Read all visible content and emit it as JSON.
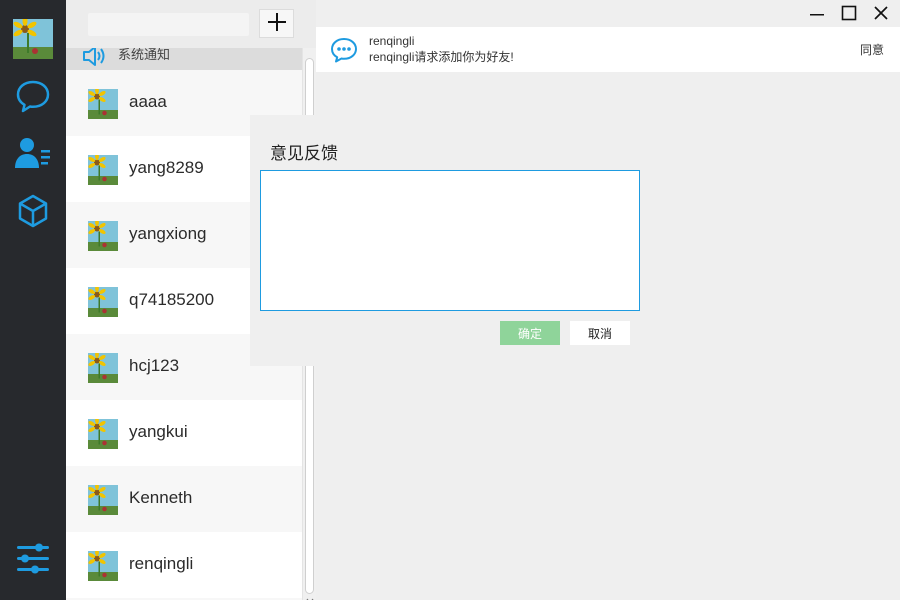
{
  "colors": {
    "rail_bg": "#27292d",
    "accent": "#1e9be0",
    "confirm_green": "#8fd49a"
  },
  "sidebar": {
    "nav_icons": [
      "chat-bubble-icon",
      "contacts-icon",
      "cube-icon"
    ],
    "settings_icon": "sliders-icon"
  },
  "search": {
    "value": "",
    "placeholder": "",
    "add_icon": "plus-icon"
  },
  "system_notice": {
    "label": "系统通知",
    "icon": "speaker-icon"
  },
  "contacts": [
    {
      "name": "aaaa"
    },
    {
      "name": "yang8289"
    },
    {
      "name": "yangxiong"
    },
    {
      "name": "q74185200"
    },
    {
      "name": "hcj123"
    },
    {
      "name": "yangkui"
    },
    {
      "name": "Kenneth"
    },
    {
      "name": "renqingli"
    }
  ],
  "notification": {
    "title": "renqingli",
    "message": "renqingli请求添加你为好友!",
    "accept_label": "同意",
    "icon": "chat-dots-icon"
  },
  "feedback_dialog": {
    "title": "意见反馈",
    "text_value": "",
    "ok_label": "确定",
    "cancel_label": "取消"
  }
}
